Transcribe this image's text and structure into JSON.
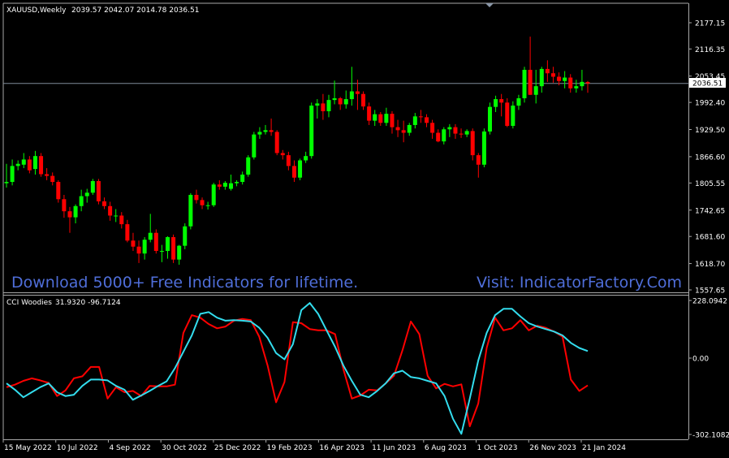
{
  "main_header": {
    "symbol": "XAUUSD,Weekly",
    "ohlc": "2039.57 2042.07 2014.78 2036.51"
  },
  "sub_header": {
    "name": "CCI Woodies",
    "values": "31.9320 -96.7124"
  },
  "watermark": {
    "left": "Download 5000+ Free Indicators for lifetime.",
    "right": "Visit: IndicatorFactory.Com"
  },
  "current_price": "2036.51",
  "colors": {
    "background": "#000000",
    "bull": "#00ff00",
    "bear": "#ff0000",
    "cci_fast": "#ff0000",
    "cci_slow": "#33ddee",
    "price_line": "#7f8c9a",
    "watermark": "#4f6ed9"
  },
  "chart_data": [
    {
      "type": "candlestick",
      "title": "XAUUSD,Weekly",
      "y_ticks": [
        "2177.15",
        "2116.35",
        "2053.45",
        "1992.40",
        "1929.50",
        "1866.60",
        "1805.55",
        "1742.65",
        "1681.60",
        "1618.70",
        "1557.65"
      ],
      "ylim": [
        1557.65,
        2177.15
      ],
      "x_ticks": [
        "15 May 2022",
        "10 Jul 2022",
        "4 Sep 2022",
        "30 Oct 2022",
        "25 Dec 2022",
        "19 Feb 2023",
        "16 Apr 2023",
        "11 Jun 2023",
        "6 Aug 2023",
        "1 Oct 2023",
        "26 Nov 2023",
        "21 Jan 2024"
      ],
      "current_price": 2036.51,
      "candles": [
        {
          "o": 1805,
          "h": 1850,
          "l": 1795,
          "c": 1808
        },
        {
          "o": 1808,
          "h": 1860,
          "l": 1800,
          "c": 1845
        },
        {
          "o": 1845,
          "h": 1858,
          "l": 1835,
          "c": 1850
        },
        {
          "o": 1848,
          "h": 1875,
          "l": 1840,
          "c": 1860
        },
        {
          "o": 1860,
          "h": 1868,
          "l": 1828,
          "c": 1835
        },
        {
          "o": 1838,
          "h": 1880,
          "l": 1825,
          "c": 1868
        },
        {
          "o": 1868,
          "h": 1875,
          "l": 1820,
          "c": 1826
        },
        {
          "o": 1826,
          "h": 1840,
          "l": 1812,
          "c": 1822
        },
        {
          "o": 1822,
          "h": 1830,
          "l": 1800,
          "c": 1808
        },
        {
          "o": 1808,
          "h": 1812,
          "l": 1760,
          "c": 1768
        },
        {
          "o": 1768,
          "h": 1778,
          "l": 1725,
          "c": 1740
        },
        {
          "o": 1740,
          "h": 1750,
          "l": 1690,
          "c": 1726
        },
        {
          "o": 1726,
          "h": 1756,
          "l": 1712,
          "c": 1752
        },
        {
          "o": 1752,
          "h": 1790,
          "l": 1740,
          "c": 1775
        },
        {
          "o": 1775,
          "h": 1792,
          "l": 1760,
          "c": 1783
        },
        {
          "o": 1783,
          "h": 1815,
          "l": 1778,
          "c": 1810
        },
        {
          "o": 1810,
          "h": 1815,
          "l": 1756,
          "c": 1763
        },
        {
          "o": 1763,
          "h": 1772,
          "l": 1745,
          "c": 1752
        },
        {
          "o": 1752,
          "h": 1762,
          "l": 1718,
          "c": 1730
        },
        {
          "o": 1730,
          "h": 1745,
          "l": 1715,
          "c": 1730
        },
        {
          "o": 1730,
          "h": 1738,
          "l": 1700,
          "c": 1710
        },
        {
          "o": 1710,
          "h": 1720,
          "l": 1668,
          "c": 1672
        },
        {
          "o": 1672,
          "h": 1690,
          "l": 1648,
          "c": 1658
        },
        {
          "o": 1658,
          "h": 1672,
          "l": 1620,
          "c": 1642
        },
        {
          "o": 1642,
          "h": 1680,
          "l": 1628,
          "c": 1674
        },
        {
          "o": 1674,
          "h": 1734,
          "l": 1668,
          "c": 1690
        },
        {
          "o": 1690,
          "h": 1698,
          "l": 1642,
          "c": 1648
        },
        {
          "o": 1648,
          "h": 1662,
          "l": 1622,
          "c": 1648
        },
        {
          "o": 1648,
          "h": 1682,
          "l": 1630,
          "c": 1680
        },
        {
          "o": 1680,
          "h": 1686,
          "l": 1620,
          "c": 1628
        },
        {
          "o": 1628,
          "h": 1662,
          "l": 1616,
          "c": 1660
        },
        {
          "o": 1660,
          "h": 1712,
          "l": 1652,
          "c": 1705
        },
        {
          "o": 1705,
          "h": 1782,
          "l": 1698,
          "c": 1778
        },
        {
          "o": 1778,
          "h": 1790,
          "l": 1758,
          "c": 1766
        },
        {
          "o": 1766,
          "h": 1772,
          "l": 1745,
          "c": 1754
        },
        {
          "o": 1754,
          "h": 1762,
          "l": 1744,
          "c": 1754
        },
        {
          "o": 1754,
          "h": 1806,
          "l": 1750,
          "c": 1802
        },
        {
          "o": 1802,
          "h": 1812,
          "l": 1790,
          "c": 1797
        },
        {
          "o": 1797,
          "h": 1810,
          "l": 1790,
          "c": 1806
        },
        {
          "o": 1792,
          "h": 1825,
          "l": 1788,
          "c": 1805
        },
        {
          "o": 1805,
          "h": 1812,
          "l": 1798,
          "c": 1808
        },
        {
          "o": 1808,
          "h": 1832,
          "l": 1802,
          "c": 1825
        },
        {
          "o": 1825,
          "h": 1870,
          "l": 1820,
          "c": 1865
        },
        {
          "o": 1865,
          "h": 1924,
          "l": 1860,
          "c": 1918
        },
        {
          "o": 1918,
          "h": 1935,
          "l": 1908,
          "c": 1924
        },
        {
          "o": 1924,
          "h": 1940,
          "l": 1918,
          "c": 1928
        },
        {
          "o": 1928,
          "h": 1955,
          "l": 1915,
          "c": 1924
        },
        {
          "o": 1924,
          "h": 1928,
          "l": 1870,
          "c": 1875
        },
        {
          "o": 1875,
          "h": 1882,
          "l": 1860,
          "c": 1870
        },
        {
          "o": 1870,
          "h": 1878,
          "l": 1835,
          "c": 1845
        },
        {
          "o": 1845,
          "h": 1858,
          "l": 1808,
          "c": 1818
        },
        {
          "o": 1818,
          "h": 1862,
          "l": 1812,
          "c": 1858
        },
        {
          "o": 1858,
          "h": 1878,
          "l": 1852,
          "c": 1868
        },
        {
          "o": 1868,
          "h": 1992,
          "l": 1862,
          "c": 1985
        },
        {
          "o": 1985,
          "h": 2000,
          "l": 1955,
          "c": 1990
        },
        {
          "o": 1990,
          "h": 2012,
          "l": 1952,
          "c": 1972
        },
        {
          "o": 1972,
          "h": 2010,
          "l": 1958,
          "c": 1998
        },
        {
          "o": 1998,
          "h": 2043,
          "l": 1988,
          "c": 2002
        },
        {
          "o": 2002,
          "h": 2005,
          "l": 1975,
          "c": 1988
        },
        {
          "o": 1988,
          "h": 2020,
          "l": 1978,
          "c": 2000
        },
        {
          "o": 2000,
          "h": 2075,
          "l": 1985,
          "c": 2018
        },
        {
          "o": 2018,
          "h": 2045,
          "l": 1975,
          "c": 2012
        },
        {
          "o": 2012,
          "h": 2018,
          "l": 1975,
          "c": 1983
        },
        {
          "o": 1983,
          "h": 1992,
          "l": 1940,
          "c": 1950
        },
        {
          "o": 1950,
          "h": 1975,
          "l": 1938,
          "c": 1965
        },
        {
          "o": 1965,
          "h": 1970,
          "l": 1938,
          "c": 1945
        },
        {
          "o": 1945,
          "h": 1980,
          "l": 1938,
          "c": 1966
        },
        {
          "o": 1966,
          "h": 1972,
          "l": 1920,
          "c": 1935
        },
        {
          "o": 1935,
          "h": 1952,
          "l": 1912,
          "c": 1928
        },
        {
          "o": 1928,
          "h": 1950,
          "l": 1900,
          "c": 1922
        },
        {
          "o": 1922,
          "h": 1945,
          "l": 1915,
          "c": 1940
        },
        {
          "o": 1940,
          "h": 1968,
          "l": 1932,
          "c": 1960
        },
        {
          "o": 1960,
          "h": 1975,
          "l": 1945,
          "c": 1958
        },
        {
          "o": 1958,
          "h": 1965,
          "l": 1935,
          "c": 1945
        },
        {
          "o": 1945,
          "h": 1952,
          "l": 1908,
          "c": 1922
        },
        {
          "o": 1922,
          "h": 1930,
          "l": 1900,
          "c": 1902
        },
        {
          "o": 1902,
          "h": 1935,
          "l": 1895,
          "c": 1930
        },
        {
          "o": 1930,
          "h": 1942,
          "l": 1912,
          "c": 1935
        },
        {
          "o": 1935,
          "h": 1942,
          "l": 1908,
          "c": 1920
        },
        {
          "o": 1920,
          "h": 1932,
          "l": 1910,
          "c": 1918
        },
        {
          "o": 1918,
          "h": 1930,
          "l": 1912,
          "c": 1926
        },
        {
          "o": 1926,
          "h": 1932,
          "l": 1858,
          "c": 1870
        },
        {
          "o": 1870,
          "h": 1875,
          "l": 1818,
          "c": 1848
        },
        {
          "o": 1848,
          "h": 1932,
          "l": 1842,
          "c": 1925
        },
        {
          "o": 1925,
          "h": 1992,
          "l": 1918,
          "c": 1982
        },
        {
          "o": 1982,
          "h": 2008,
          "l": 1970,
          "c": 2000
        },
        {
          "o": 2000,
          "h": 2012,
          "l": 1960,
          "c": 1992
        },
        {
          "o": 1992,
          "h": 2002,
          "l": 1935,
          "c": 1938
        },
        {
          "o": 1938,
          "h": 1995,
          "l": 1932,
          "c": 1985
        },
        {
          "o": 1985,
          "h": 2010,
          "l": 1975,
          "c": 2002
        },
        {
          "o": 2002,
          "h": 2075,
          "l": 1992,
          "c": 2068
        },
        {
          "o": 2068,
          "h": 2145,
          "l": 2010,
          "c": 2010
        },
        {
          "o": 2010,
          "h": 2068,
          "l": 1990,
          "c": 2030
        },
        {
          "o": 2030,
          "h": 2075,
          "l": 2015,
          "c": 2070
        },
        {
          "o": 2070,
          "h": 2090,
          "l": 2040,
          "c": 2060
        },
        {
          "o": 2060,
          "h": 2075,
          "l": 2038,
          "c": 2052
        },
        {
          "o": 2052,
          "h": 2062,
          "l": 2032,
          "c": 2042
        },
        {
          "o": 2042,
          "h": 2065,
          "l": 2025,
          "c": 2050
        },
        {
          "o": 2050,
          "h": 2058,
          "l": 2015,
          "c": 2025
        },
        {
          "o": 2025,
          "h": 2045,
          "l": 2015,
          "c": 2030
        },
        {
          "o": 2030,
          "h": 2068,
          "l": 2020,
          "c": 2040
        },
        {
          "o": 2039.57,
          "h": 2042.07,
          "l": 2014.78,
          "c": 2036.51
        }
      ]
    },
    {
      "type": "line",
      "title": "CCI Woodies 31.9320 -96.7124",
      "ylim": [
        -302.1082,
        228.0942
      ],
      "y_ticks": [
        "228.0942",
        "0.00",
        "-302.1082"
      ],
      "series": [
        {
          "color": "#ff0000",
          "values": [
            -115,
            -105,
            -90,
            -80,
            -88,
            -98,
            -150,
            -128,
            -80,
            -72,
            -35,
            -35,
            -160,
            -115,
            -135,
            -130,
            -150,
            -110,
            -112,
            -112,
            -105,
            100,
            170,
            160,
            135,
            118,
            125,
            148,
            155,
            150,
            85,
            -30,
            -175,
            -95,
            142,
            138,
            115,
            110,
            110,
            95,
            -45,
            -160,
            -148,
            -125,
            -128,
            -100,
            -70,
            30,
            145,
            95,
            -70,
            -120,
            -102,
            -112,
            -104,
            -270,
            -180,
            40,
            160,
            110,
            118,
            150,
            110,
            128,
            120,
            105,
            85,
            -85,
            -130,
            -108
          ]
        },
        {
          "color": "#33ddee",
          "values": [
            -100,
            -125,
            -155,
            -135,
            -115,
            -100,
            -135,
            -150,
            -145,
            -110,
            -85,
            -85,
            -88,
            -110,
            -125,
            -165,
            -148,
            -130,
            -110,
            -92,
            -40,
            25,
            90,
            175,
            182,
            160,
            148,
            150,
            148,
            145,
            120,
            80,
            20,
            -5,
            55,
            190,
            218,
            175,
            110,
            45,
            -30,
            -90,
            -145,
            -155,
            -130,
            -100,
            -60,
            -50,
            -75,
            -80,
            -90,
            -100,
            -150,
            -240,
            -300,
            -160,
            -10,
            100,
            170,
            195,
            195,
            165,
            138,
            125,
            115,
            105,
            90,
            60,
            40,
            28
          ]
        }
      ]
    }
  ]
}
